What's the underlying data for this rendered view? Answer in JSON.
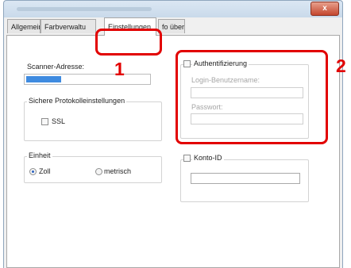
{
  "window": {
    "close_symbol": "x"
  },
  "tabs": [
    {
      "label": "Allgemein"
    },
    {
      "label": "Farbverwaltu"
    },
    {
      "label": "Einstellungen"
    },
    {
      "label": "fo über"
    }
  ],
  "scanner": {
    "label": "Scanner-Adresse:"
  },
  "secure": {
    "title": "Sichere Protokolleinstellungen",
    "ssl_label": "SSL"
  },
  "unit": {
    "title": "Einheit",
    "option_inch": "Zoll",
    "option_metric": "metrisch",
    "selected": "Zoll"
  },
  "auth": {
    "checkbox_label": "Authentifizierung",
    "login_label": "Login-Benutzername:",
    "password_label": "Passwort:"
  },
  "account": {
    "checkbox_label": "Konto-ID"
  },
  "annotations": {
    "marker1": "1",
    "marker2": "2",
    "color": "#e20000"
  }
}
